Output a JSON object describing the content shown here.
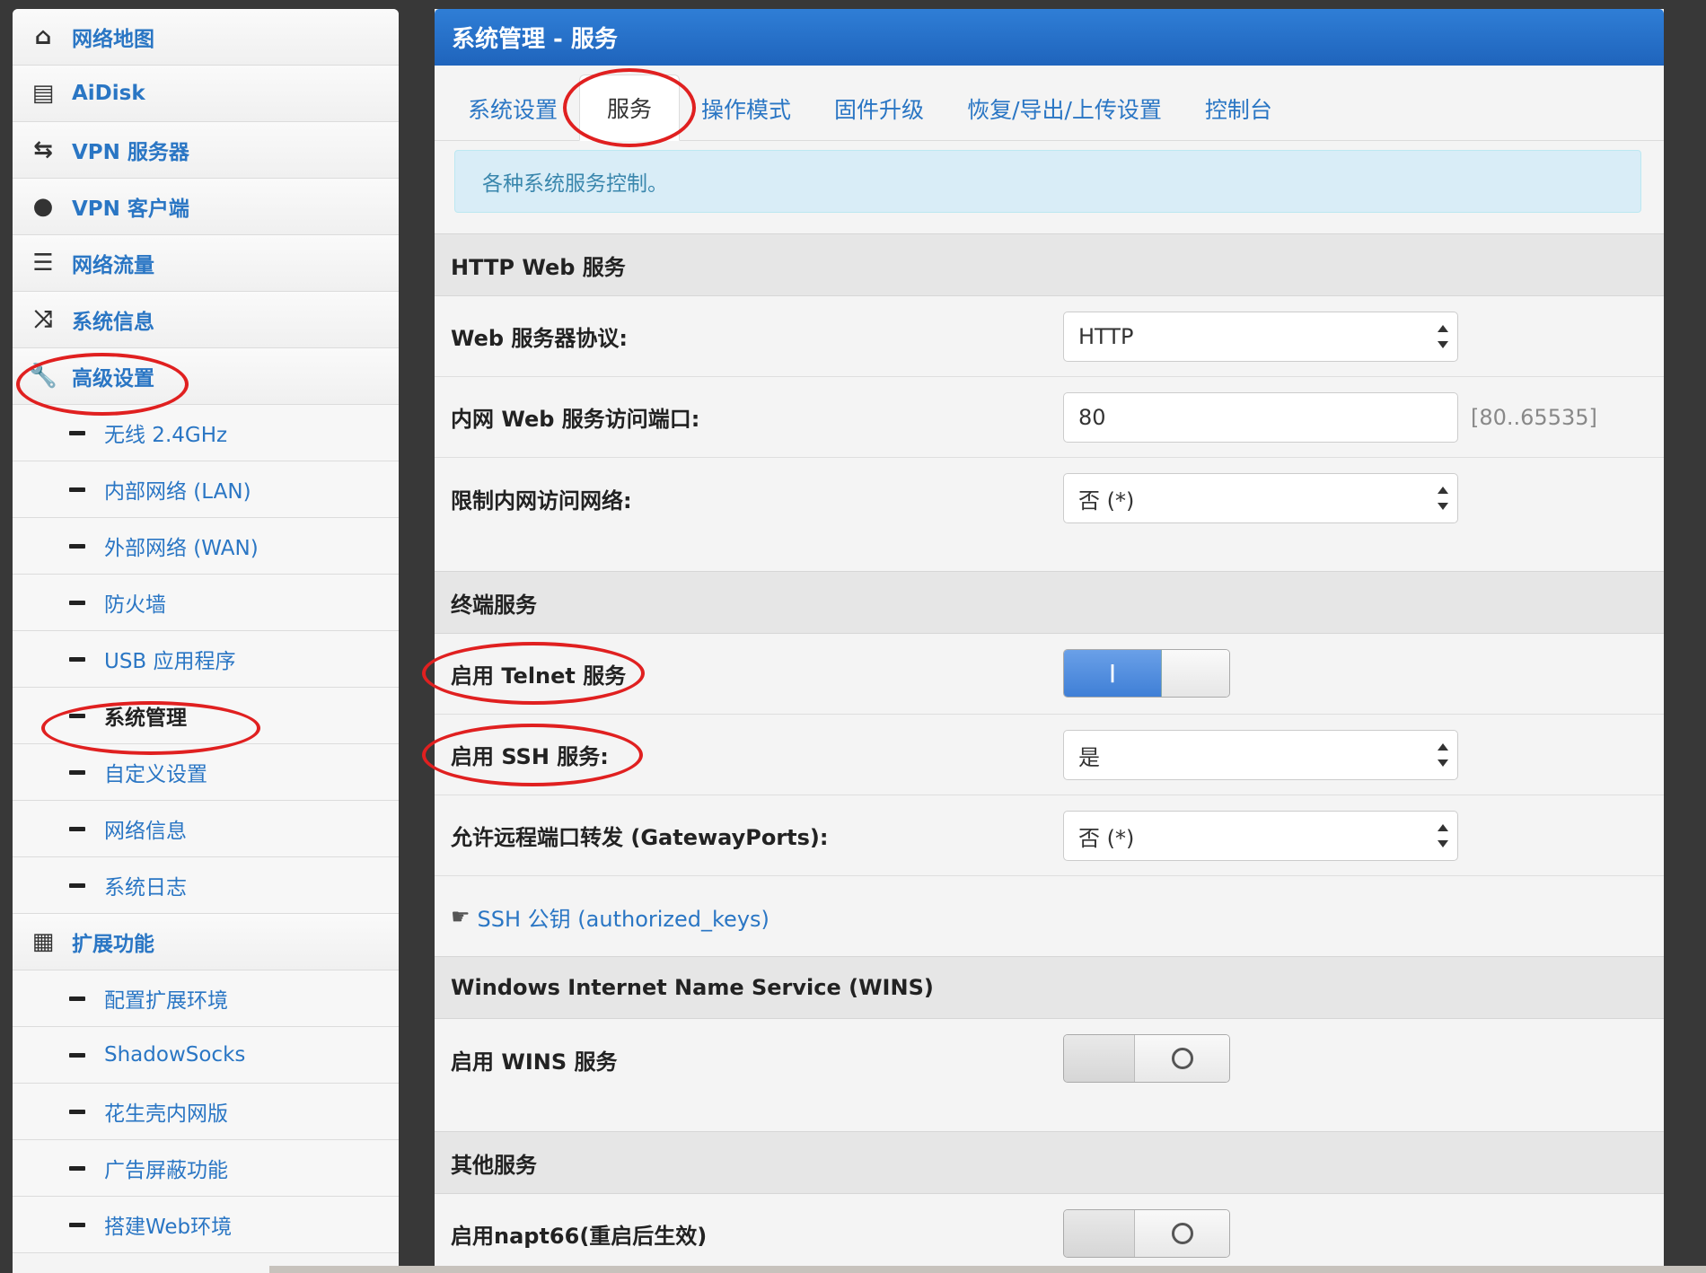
{
  "sidebar": {
    "items": [
      {
        "label": "网络地图",
        "icon": "home-icon",
        "glyph": "⌂",
        "type": "top"
      },
      {
        "label": "AiDisk",
        "icon": "disk-icon",
        "glyph": "▤",
        "type": "top"
      },
      {
        "label": "VPN 服务器",
        "icon": "swap-icon",
        "glyph": "⇆",
        "type": "top"
      },
      {
        "label": "VPN 客户端",
        "icon": "globe-icon",
        "glyph": "●",
        "type": "top"
      },
      {
        "label": "网络流量",
        "icon": "list-icon",
        "glyph": "☰",
        "type": "top"
      },
      {
        "label": "系统信息",
        "icon": "shuffle-icon",
        "glyph": "⤨",
        "type": "top"
      },
      {
        "label": "高级设置",
        "icon": "wrench-icon",
        "glyph": "🔧",
        "type": "top"
      },
      {
        "label": "无线 2.4GHz",
        "type": "sub"
      },
      {
        "label": "内部网络 (LAN)",
        "type": "sub"
      },
      {
        "label": "外部网络 (WAN)",
        "type": "sub"
      },
      {
        "label": "防火墙",
        "type": "sub"
      },
      {
        "label": "USB 应用程序",
        "type": "sub"
      },
      {
        "label": "系统管理",
        "type": "sub",
        "active": true
      },
      {
        "label": "自定义设置",
        "type": "sub"
      },
      {
        "label": "网络信息",
        "type": "sub"
      },
      {
        "label": "系统日志",
        "type": "sub"
      },
      {
        "label": "扩展功能",
        "icon": "grid-icon",
        "glyph": "▦",
        "type": "top"
      },
      {
        "label": "配置扩展环境",
        "type": "sub"
      },
      {
        "label": "ShadowSocks",
        "type": "sub"
      },
      {
        "label": "花生壳内网版",
        "type": "sub"
      },
      {
        "label": "广告屏蔽功能",
        "type": "sub"
      },
      {
        "label": "搭建Web环境",
        "type": "sub"
      }
    ]
  },
  "header": {
    "title": "系统管理 - 服务"
  },
  "tabs": [
    {
      "label": "系统设置"
    },
    {
      "label": "服务",
      "active": true
    },
    {
      "label": "操作模式"
    },
    {
      "label": "固件升级"
    },
    {
      "label": "恢复/导出/上传设置"
    },
    {
      "label": "控制台"
    }
  ],
  "info": "各种系统服务控制。",
  "sections": {
    "http": {
      "title": "HTTP Web 服务",
      "protocol_label": "Web 服务器协议:",
      "protocol_value": "HTTP",
      "port_label": "内网 Web 服务访问端口:",
      "port_value": "80",
      "port_hint": "[80..65535]",
      "restrict_label": "限制内网访问网络:",
      "restrict_value": "否 (*)"
    },
    "terminal": {
      "title": "终端服务",
      "telnet_label": "启用 Telnet 服务",
      "telnet_on_glyph": "I",
      "ssh_label": "启用 SSH 服务:",
      "ssh_value": "是",
      "gateway_label": "允许远程端口转发 (GatewayPorts):",
      "gateway_value": "否 (*)",
      "keys_link": "SSH 公钥 (authorized_keys)"
    },
    "wins": {
      "title": "Windows Internet Name Service (WINS)",
      "enable_label": "启用 WINS 服务"
    },
    "other": {
      "title": "其他服务",
      "napt_label": "启用napt66(重启后生效)"
    }
  },
  "colors": {
    "accent": "#2a76c4",
    "header": "#2f7ed6",
    "annotation": "#e02020"
  }
}
